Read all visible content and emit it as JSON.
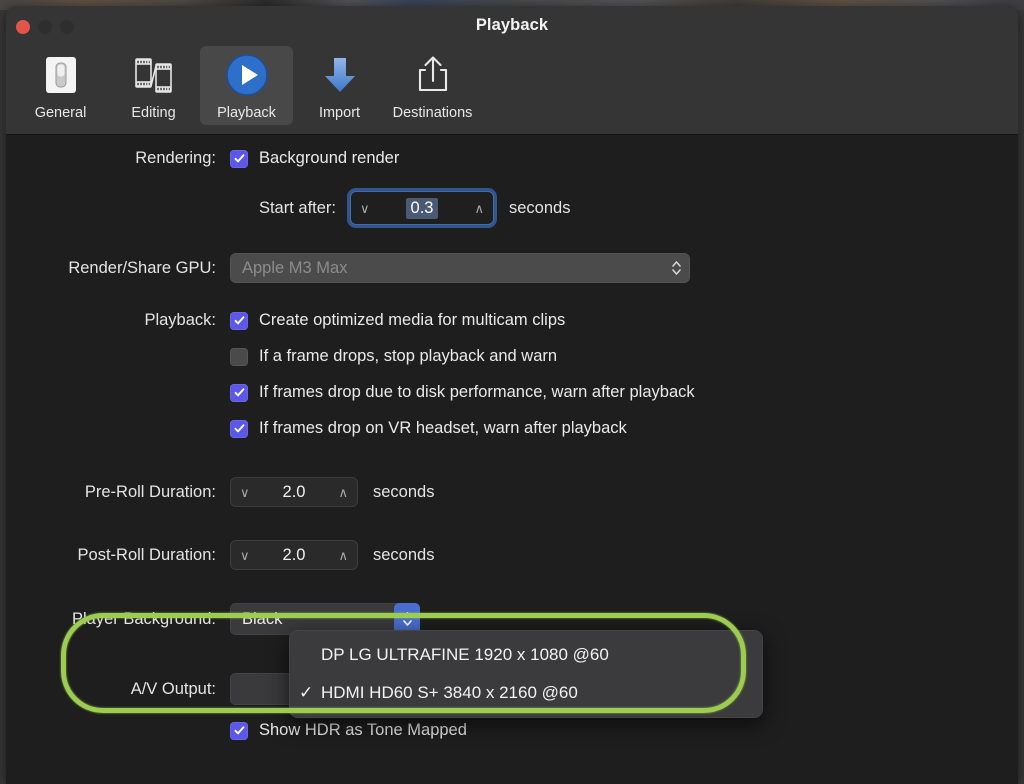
{
  "window": {
    "title": "Playback",
    "traffic_lights": [
      "close",
      "minimize",
      "zoom"
    ]
  },
  "toolbar": {
    "items": [
      {
        "label": "General",
        "icon": "general-switch-icon",
        "selected": false
      },
      {
        "label": "Editing",
        "icon": "film-strip-icon",
        "selected": false
      },
      {
        "label": "Playback",
        "icon": "play-circle-icon",
        "selected": true
      },
      {
        "label": "Import",
        "icon": "download-arrow-icon",
        "selected": false
      },
      {
        "label": "Destinations",
        "icon": "share-export-icon",
        "selected": false
      }
    ]
  },
  "form": {
    "rendering": {
      "label": "Rendering:",
      "background_render": {
        "label": "Background render",
        "checked": true
      },
      "start_after": {
        "label": "Start after:",
        "value": "0.3",
        "unit": "seconds",
        "focused": true
      }
    },
    "gpu": {
      "label": "Render/Share GPU:",
      "value": "Apple M3 Max",
      "disabled": true
    },
    "playback": {
      "label": "Playback:",
      "options": [
        {
          "label": "Create optimized media for multicam clips",
          "checked": true
        },
        {
          "label": "If a frame drops, stop playback and warn",
          "checked": false
        },
        {
          "label": "If frames drop due to disk performance, warn after playback",
          "checked": true
        },
        {
          "label": "If frames drop on VR headset, warn after playback",
          "checked": true
        }
      ]
    },
    "pre_roll": {
      "label": "Pre-Roll Duration:",
      "value": "2.0",
      "unit": "seconds"
    },
    "post_roll": {
      "label": "Post-Roll Duration:",
      "value": "2.0",
      "unit": "seconds"
    },
    "player_background": {
      "label": "Player Background:",
      "value": "Black"
    },
    "av_output": {
      "label": "A/V Output:"
    },
    "hdr": {
      "label": "Show HDR as Tone Mapped",
      "checked": true
    }
  },
  "av_output_menu": {
    "items": [
      {
        "label": "DP LG ULTRAFINE 1920 x 1080 @60",
        "checked": false,
        "check_glyph": ""
      },
      {
        "label": "HDMI HD60 S+ 3840 x 2160 @60",
        "checked": true,
        "check_glyph": "✓"
      }
    ]
  },
  "annotation": {
    "shape": "rounded-rectangle-highlight",
    "color": "#9ccc50"
  },
  "glyphs": {
    "chevron_down": "∨",
    "chevron_up": "∧",
    "updown": "⇅"
  }
}
